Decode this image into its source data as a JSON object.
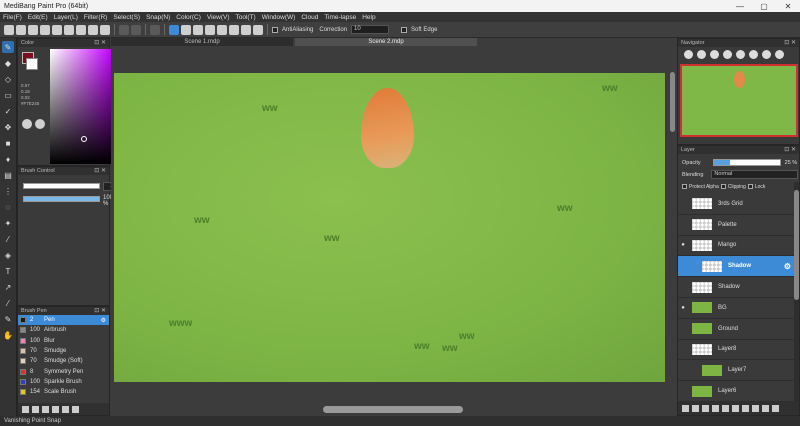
{
  "window": {
    "title": "MediBang Paint Pro (64bit)",
    "controls": [
      "—",
      "▢",
      "✕"
    ]
  },
  "menu": [
    "File(F)",
    "Edit(E)",
    "Layer(L)",
    "Filter(R)",
    "Select(S)",
    "Snap(N)",
    "Color(C)",
    "View(V)",
    "Tool(T)",
    "Window(W)",
    "Cloud",
    "Time-lapse",
    "Help"
  ],
  "toolbar": {
    "antialiasing_label": "AntiAliasing",
    "correction_label": "Correction",
    "correction_value": "10",
    "softedge_label": "Soft Edge"
  },
  "left_tools": [
    "brush",
    "eraser",
    "eraser-2",
    "rect-select",
    "pen",
    "move",
    "fill-rect",
    "bucket",
    "gradient",
    "dot",
    "lasso",
    "magic-wand",
    "dropper",
    "eraser-3",
    "text",
    "operation",
    "eyedropper",
    "select-pen",
    "hand"
  ],
  "color_panel": {
    "title": "Color",
    "primary_color": "#7b0d1e",
    "secondary_color": "#ffffff",
    "values": [
      "0.57",
      "0.18",
      "0.02",
      "#F7E245"
    ]
  },
  "brush_control": {
    "title": "Brush Control",
    "size_value": "2",
    "opacity_value": "100 %"
  },
  "brush_list": {
    "title": "Brush Pen",
    "items": [
      {
        "num": "2",
        "name": "Pen",
        "color": "#1a1a1a",
        "selected": true
      },
      {
        "num": "100",
        "name": "Airbrush",
        "color": "#888888"
      },
      {
        "num": "100",
        "name": "Blur",
        "color": "#f080c0"
      },
      {
        "num": "70",
        "name": "Smudge",
        "color": "#e0c0a0"
      },
      {
        "num": "70",
        "name": "Smudge (Soft)",
        "color": "#e8d0b8"
      },
      {
        "num": "8",
        "name": "Symmetry Pen",
        "color": "#e03030"
      },
      {
        "num": "100",
        "name": "Sparkle Brush",
        "color": "#3040c0"
      },
      {
        "num": "154",
        "name": "Scale Brush",
        "color": "#f0c020"
      }
    ]
  },
  "tabs": [
    "Scene 1.mdp",
    "Scene 2.mdp"
  ],
  "navigator": {
    "title": "Navigator"
  },
  "layer_panel": {
    "title": "Layer",
    "opacity_label": "Opacity",
    "opacity_value": "25 %",
    "opacity_fraction": 0.25,
    "blending_label": "Blending",
    "blending_value": "Normal",
    "protect_alpha": "Protect Alpha",
    "clipping": "Clipping",
    "lock": "Lock",
    "layers": [
      {
        "name": "3rds Grid",
        "visible": false
      },
      {
        "name": "Palette",
        "visible": false
      },
      {
        "name": "Mango",
        "visible": true
      },
      {
        "name": "Shadow",
        "visible": false,
        "selected": true
      },
      {
        "name": "Shadow",
        "visible": false
      },
      {
        "name": "BG",
        "visible": true
      },
      {
        "name": "Ground",
        "visible": false
      },
      {
        "name": "Layer8",
        "visible": false
      },
      {
        "name": "Layer7",
        "visible": false
      },
      {
        "name": "Layer6",
        "visible": false
      }
    ]
  },
  "status": "Vanishing Point Snap"
}
